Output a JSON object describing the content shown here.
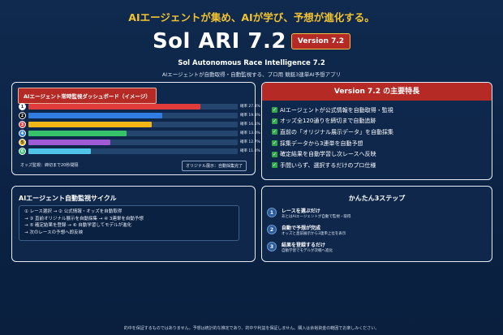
{
  "header": {
    "tagline": "AIエージェントが集め、AIが学び、予想が進化する。",
    "title": "Sol ARI 7.2",
    "version_badge": "Version 7.2",
    "subtitle": "Sol Autonomous Race Intelligence 7.2",
    "description": "AIエージェントが自動取得・自動監視する、プロ用 競艇3連単AI予想アプリ"
  },
  "dashboard": {
    "title": "AIエージェント常時監視ダッシュボード（イメージ）",
    "bars": [
      {
        "num": "1",
        "label": "確率 27.4%",
        "fill": 0.82,
        "color": "#e23b3b",
        "badge_color": "#ffffff",
        "badge_text_color": "#0b2244"
      },
      {
        "num": "2",
        "label": "確率 19.8%",
        "fill": 0.64,
        "color": "#2f7de0",
        "badge_color": "#000000",
        "badge_text_color": "#ffffff"
      },
      {
        "num": "3",
        "label": "確率 16.1%",
        "fill": 0.59,
        "color": "#f1b516",
        "badge_color": "#e23b3b",
        "badge_text_color": "#ffffff"
      },
      {
        "num": "4",
        "label": "確率 13.0%",
        "fill": 0.47,
        "color": "#36c26b",
        "badge_color": "#2f7de0",
        "badge_text_color": "#ffffff"
      },
      {
        "num": "5",
        "label": "確率 12.7%",
        "fill": 0.39,
        "color": "#a05ad6",
        "badge_color": "#f1b516",
        "badge_text_color": "#0b2244"
      },
      {
        "num": "6",
        "label": "確率 11.0%",
        "fill": 0.3,
        "color": "#4fc3e8",
        "badge_color": "#36c26b",
        "badge_text_color": "#ffffff"
      }
    ],
    "footer_left": "オッズ監視：締切まで20秒間隔",
    "footer_right": "オリジナル展示：自動採集完了"
  },
  "features": {
    "title": "Version 7.2 の主要特長",
    "items": [
      "AIエージェントが公式情報を自動取得・監視",
      "オッズ全120通りを締切まで自動追跡",
      "直前の「オリジナル展示データ」を自動採集",
      "採集データから3連単を自動予想",
      "確定結果を自動学習し次レースへ反映",
      "手間いらず、選択するだけのプロ仕様"
    ]
  },
  "cycle": {
    "title": "AIエージェント自動監視サイクル",
    "lines": [
      "① レース選択 → ② 公式情報・オッズを自動取得",
      "→ ③ 直前オリジナル展示を自動採集 → ④ 3連単を自動予想",
      "→ ⑤ 確定結果を登録 → ⑥ 自動学習してモデルが進化",
      "→ 次のレースの予想へ即反映"
    ]
  },
  "steps": {
    "title": "かんたん3ステップ",
    "items": [
      {
        "num": "1",
        "title": "レースを選ぶだけ",
        "desc": "あとはAIエージェントが自動で監視・取得"
      },
      {
        "num": "2",
        "title": "自動で予想が完成",
        "desc": "オッズと直前展示から3連単上位を表示"
      },
      {
        "num": "3",
        "title": "結果を登録するだけ",
        "desc": "自動学習でモデルが次戦へ進化"
      }
    ]
  },
  "disclaimer": "的中を保証するものではありません。予想は統計的な推定であり、的中や利益を保証しません。購入は余裕資金の範囲でお楽しみください。"
}
